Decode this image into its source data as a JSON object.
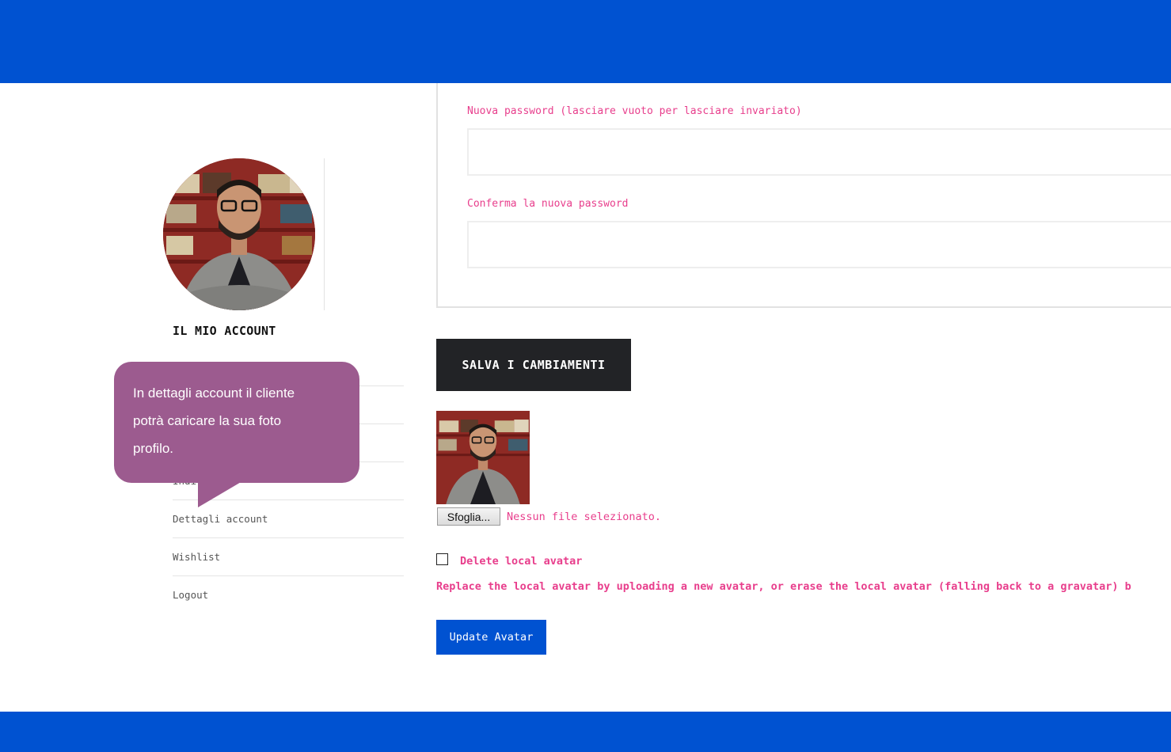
{
  "colors": {
    "brand_blue": "#0052d1",
    "label_pink": "#e83e8c",
    "tooltip_purple": "#9c5b8f",
    "dark_button": "#222326"
  },
  "sidebar": {
    "title": "IL MIO ACCOUNT",
    "items": [
      {
        "label": ""
      },
      {
        "label": ""
      },
      {
        "label": "Indiri"
      },
      {
        "label": "Dettagli account"
      },
      {
        "label": "Wishlist"
      },
      {
        "label": "Logout"
      }
    ]
  },
  "tooltip": {
    "lines": [
      "In dettagli account il cliente",
      "potrà caricare la sua foto",
      "profilo."
    ]
  },
  "form": {
    "new_password_label": "Nuova password (lasciare vuoto per lasciare invariato)",
    "confirm_password_label": "Conferma la nuova password",
    "save_label": "SALVA I CAMBIAMENTI"
  },
  "avatar_section": {
    "browse_label": "Sfoglia...",
    "no_file_text": "Nessun file selezionato.",
    "delete_label": "Delete local avatar",
    "replace_text": "Replace the local avatar by uploading a new avatar, or erase the local avatar (falling back to a gravatar) b",
    "update_label": "Update Avatar"
  }
}
